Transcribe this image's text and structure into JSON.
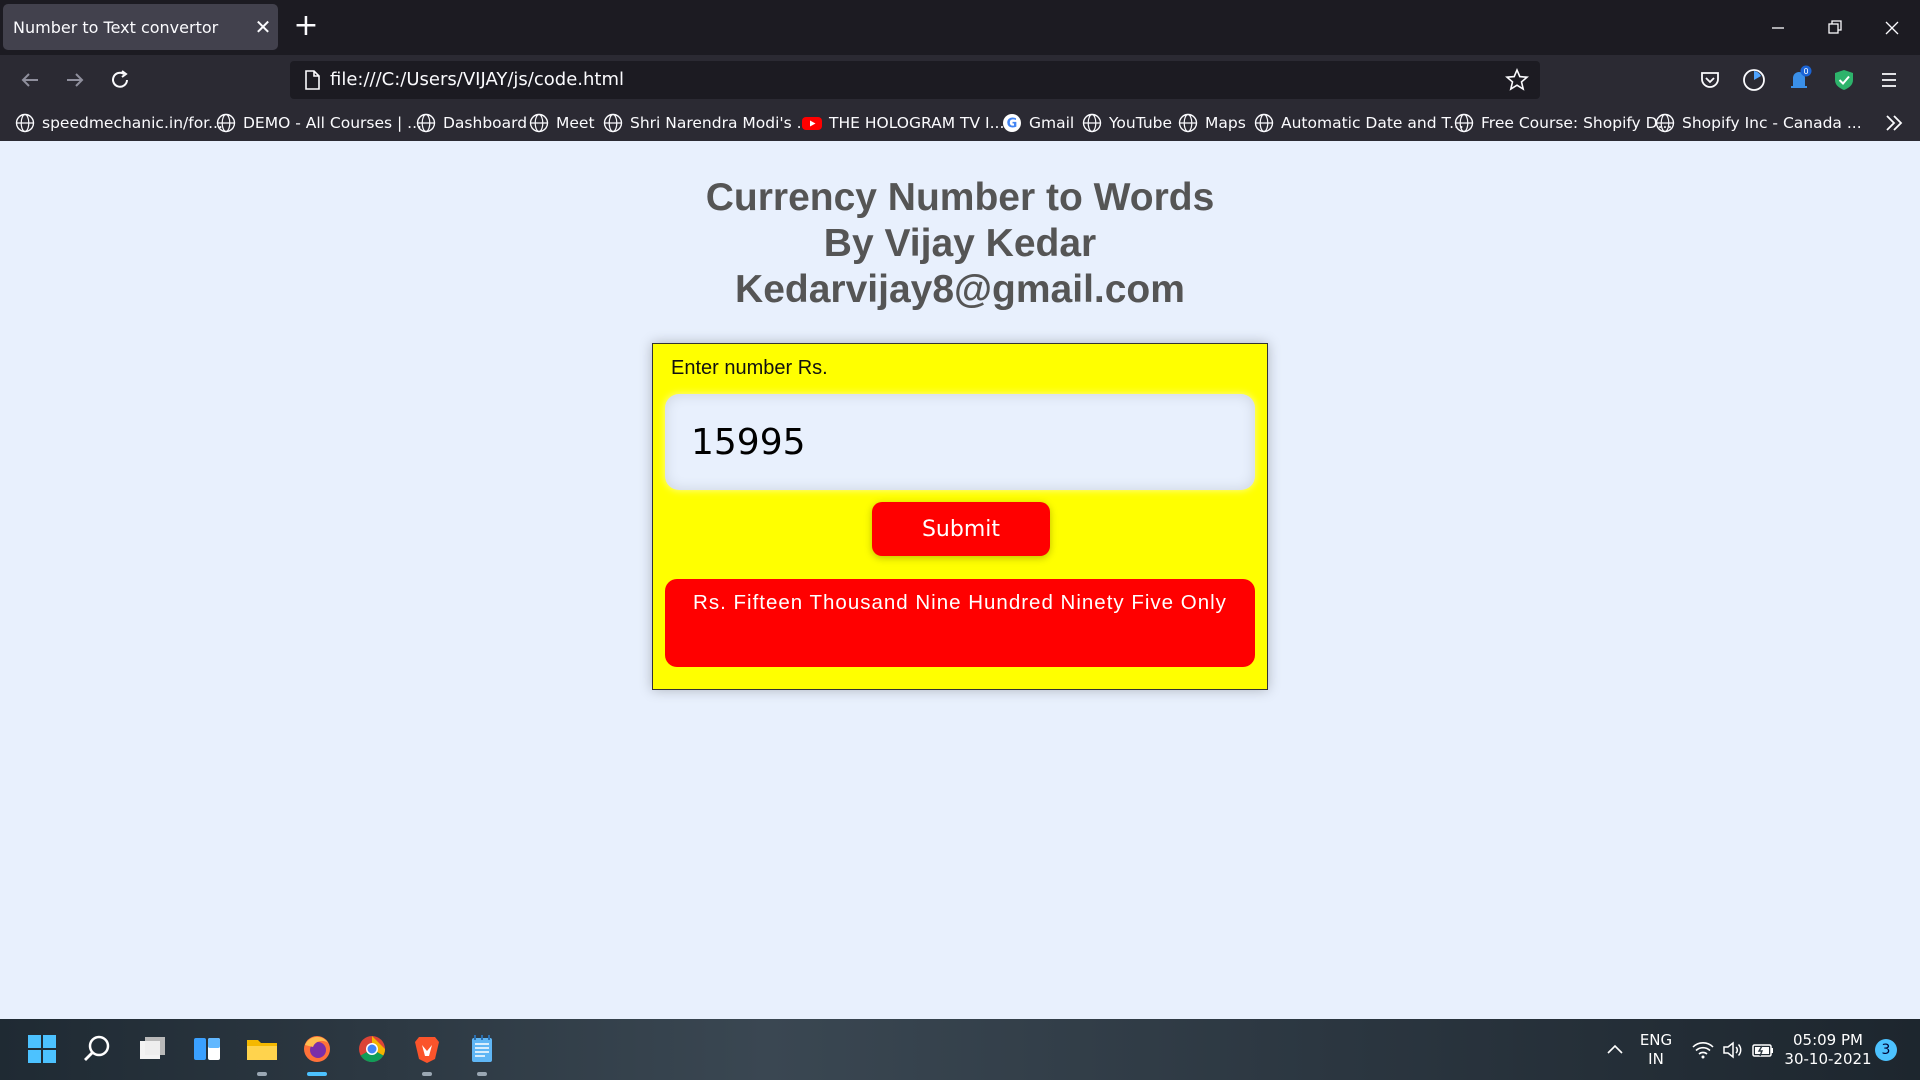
{
  "browser": {
    "tab_title": "Number to Text convertor",
    "url": "file:///C:/Users/VIJAY/js/code.html",
    "pocket_badge": "0"
  },
  "bookmarks": [
    {
      "label": "speedmechanic.in/for...",
      "icon": "globe-icon"
    },
    {
      "label": "DEMO - All Courses | ...",
      "icon": "globe-icon"
    },
    {
      "label": "Dashboard",
      "icon": "globe-icon"
    },
    {
      "label": "Meet",
      "icon": "globe-icon"
    },
    {
      "label": "Shri Narendra Modi's ...",
      "icon": "globe-icon"
    },
    {
      "label": "THE HOLOGRAM TV I...",
      "icon": "youtube-icon"
    },
    {
      "label": "Gmail",
      "icon": "google-icon"
    },
    {
      "label": "YouTube",
      "icon": "globe-icon"
    },
    {
      "label": "Maps",
      "icon": "globe-icon"
    },
    {
      "label": "Automatic Date and T...",
      "icon": "globe-icon"
    },
    {
      "label": "Free Course: Shopify D...",
      "icon": "globe-icon"
    },
    {
      "label": "Shopify Inc - Canada ...",
      "icon": "globe-icon"
    }
  ],
  "page": {
    "heading_line1": "Currency Number to Words",
    "heading_line2": "By Vijay Kedar",
    "heading_line3": "Kedarvijay8@gmail.com",
    "input_label": "Enter number Rs.",
    "input_value": "15995",
    "submit_label": "Submit",
    "result_text": "Rs. Fifteen Thousand Nine Hundred Ninety Five Only"
  },
  "taskbar": {
    "lang_line1": "ENG",
    "lang_line2": "IN",
    "time": "05:09 PM",
    "date": "30-10-2021",
    "notification_count": "3"
  },
  "colors": {
    "page_bg": "#e8f0fd",
    "card_bg": "#ffff00",
    "accent_red": "#ff0000",
    "heading_gray": "#555555"
  }
}
